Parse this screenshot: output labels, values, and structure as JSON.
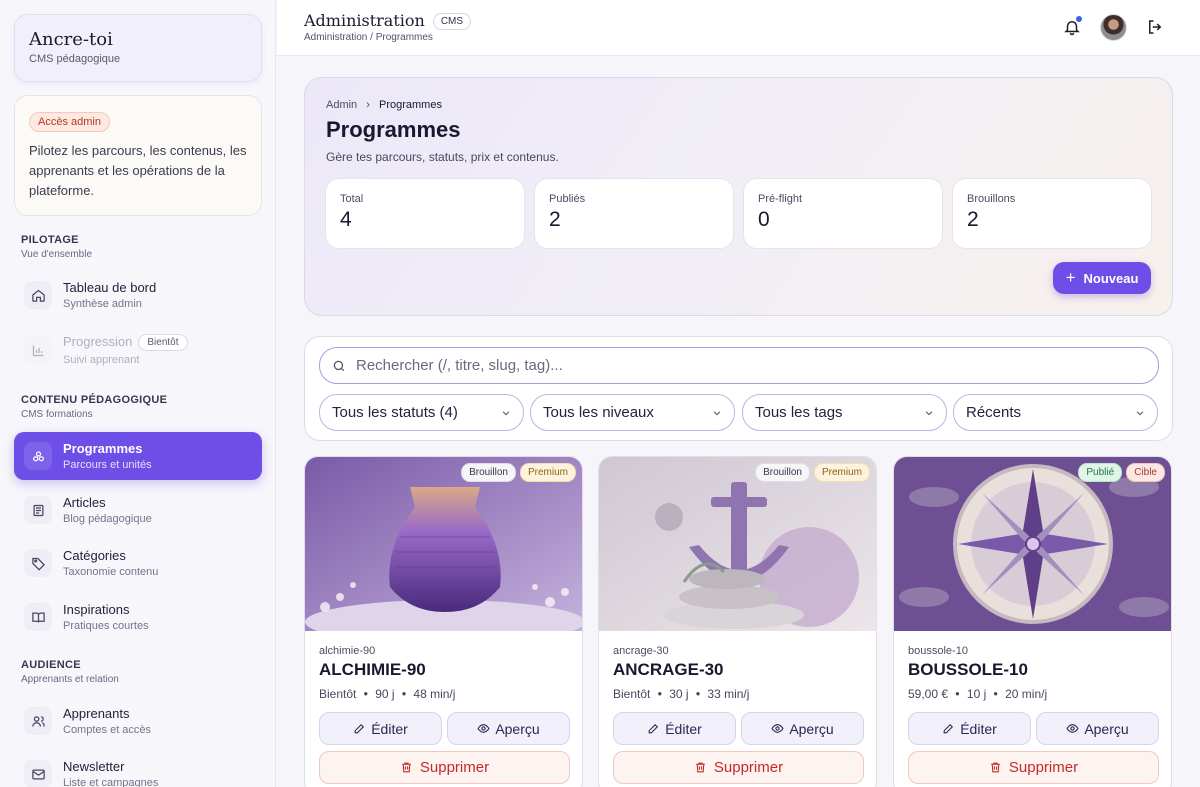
{
  "brand": {
    "title": "Ancre-toi",
    "subtitle": "CMS pédagogique"
  },
  "info": {
    "badge": "Accès admin",
    "text": "Pilotez les parcours, les contenus, les apprenants et les opérations de la plateforme."
  },
  "sidebar": {
    "sections": [
      {
        "title": "PILOTAGE",
        "subtitle": "Vue d'ensemble"
      },
      {
        "title": "CONTENU PÉDAGOGIQUE",
        "subtitle": "CMS formations"
      },
      {
        "title": "AUDIENCE",
        "subtitle": "Apprenants et relation"
      }
    ],
    "items": [
      {
        "label": "Tableau de bord",
        "sub": "Synthèse admin",
        "icon": "home-icon"
      },
      {
        "label": "Progression",
        "sub": "Suivi apprenant",
        "badge": "Bientôt",
        "icon": "bar-chart-icon"
      },
      {
        "label": "Programmes",
        "sub": "Parcours et unités",
        "icon": "layers-icon"
      },
      {
        "label": "Articles",
        "sub": "Blog pédagogique",
        "icon": "newspaper-icon"
      },
      {
        "label": "Catégories",
        "sub": "Taxonomie contenu",
        "icon": "tag-icon"
      },
      {
        "label": "Inspirations",
        "sub": "Pratiques courtes",
        "icon": "book-icon"
      },
      {
        "label": "Apprenants",
        "sub": "Comptes et accès",
        "icon": "users-icon"
      },
      {
        "label": "Newsletter",
        "sub": "Liste et campagnes",
        "icon": "mail-icon"
      }
    ]
  },
  "topbar": {
    "title": "Administration",
    "badge": "CMS",
    "breadcrumb": "Administration / Programmes"
  },
  "hero": {
    "breadcrumb_root": "Admin",
    "breadcrumb_sep": "›",
    "breadcrumb_current": "Programmes",
    "title": "Programmes",
    "description": "Gère tes parcours, statuts, prix et contenus.",
    "stats": [
      {
        "label": "Total",
        "value": "4"
      },
      {
        "label": "Publiés",
        "value": "2"
      },
      {
        "label": "Pré-flight",
        "value": "0"
      },
      {
        "label": "Brouillons",
        "value": "2"
      }
    ],
    "new_button": "Nouveau"
  },
  "filters": {
    "search_placeholder": "Rechercher (/, titre, slug, tag)...",
    "selects": [
      "Tous les statuts (4)",
      "Tous les niveaux",
      "Tous les tags",
      "Récents"
    ]
  },
  "cards": [
    {
      "slug": "alchimie-90",
      "name": "ALCHIMIE-90",
      "price": "Bientôt",
      "duration": "90 j",
      "rhythm": "48 min/j",
      "badges": [
        "Brouillon",
        "Premium"
      ]
    },
    {
      "slug": "ancrage-30",
      "name": "ANCRAGE-30",
      "price": "Bientôt",
      "duration": "30 j",
      "rhythm": "33 min/j",
      "badges": [
        "Brouillon",
        "Premium"
      ]
    },
    {
      "slug": "boussole-10",
      "name": "BOUSSOLE-10",
      "price": "59,00 €",
      "duration": "10 j",
      "rhythm": "20 min/j",
      "badges": [
        "Publié",
        "Cible"
      ]
    }
  ],
  "card_actions": {
    "edit": "Éditer",
    "preview": "Aperçu",
    "delete": "Supprimer"
  },
  "colors": {
    "accent": "#6d4ee6",
    "danger": "#c42a2a"
  }
}
